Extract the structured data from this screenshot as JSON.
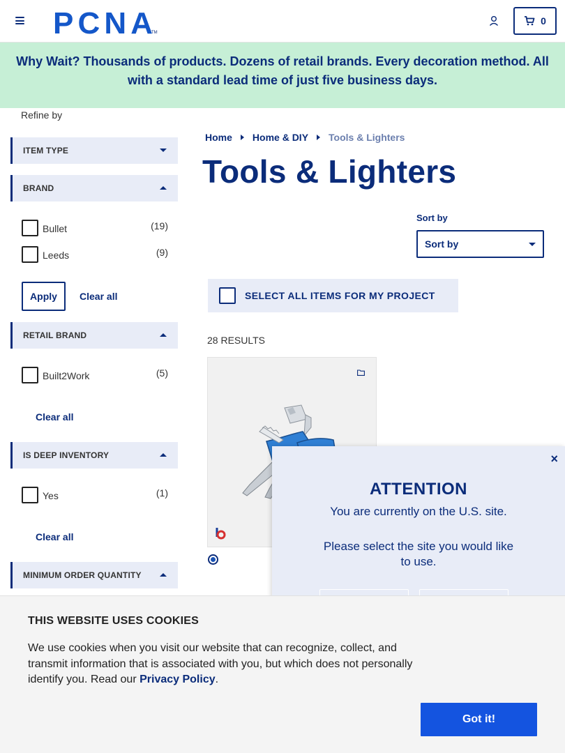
{
  "header": {
    "logo_text": "PCNA",
    "cart_count": "0"
  },
  "banner": {
    "text": "Why Wait? Thousands of products. Dozens of retail brands. Every decoration method. All with a standard lead time of just five business days."
  },
  "sidebar": {
    "refine_label": "Refine by",
    "facets": [
      {
        "label": "ITEM TYPE",
        "expanded": false
      },
      {
        "label": "BRAND",
        "expanded": true,
        "options": [
          {
            "label": "Bullet",
            "count": "(19)"
          },
          {
            "label": "Leeds",
            "count": "(9)"
          }
        ],
        "apply_label": "Apply",
        "clear_label": "Clear all"
      },
      {
        "label": "RETAIL BRAND",
        "expanded": true,
        "options": [
          {
            "label": "Built2Work",
            "count": "(5)"
          }
        ],
        "clear_label": "Clear all"
      },
      {
        "label": "IS DEEP INVENTORY",
        "expanded": true,
        "options": [
          {
            "label": "Yes",
            "count": "(1)"
          }
        ],
        "clear_label": "Clear all"
      },
      {
        "label": "MINIMUM ORDER QUANTITY",
        "expanded": true
      }
    ]
  },
  "breadcrumb": {
    "items": [
      "Home",
      "Home & DIY",
      "Tools & Lighters"
    ]
  },
  "main": {
    "title": "Tools & Lighters",
    "sort_label": "Sort by",
    "sort_value": "Sort by",
    "select_all_label": "SELECT ALL ITEMS FOR MY PROJECT",
    "results_text": "28 RESULTS"
  },
  "modal": {
    "close_glyph": "×",
    "heading": "ATTENTION",
    "message1": "You are currently on the U.S. site.",
    "message2": "Please select the site you would like to use."
  },
  "cookie": {
    "heading": "THIS WEBSITE USES COOKIES",
    "text_before": "We use cookies when you visit our website that can recognize, collect, and transmit information that is associated with you, but which does not personally identify you. Read our ",
    "link_text": "Privacy Policy",
    "text_after": ".",
    "button_label": "Got it!"
  },
  "colors": {
    "brand_navy": "#0b2c7a",
    "banner_green": "#c6efd6",
    "facet_bg": "#e8ecf7",
    "accept_blue": "#1454e0",
    "product_blue": "#2f7fd4"
  }
}
